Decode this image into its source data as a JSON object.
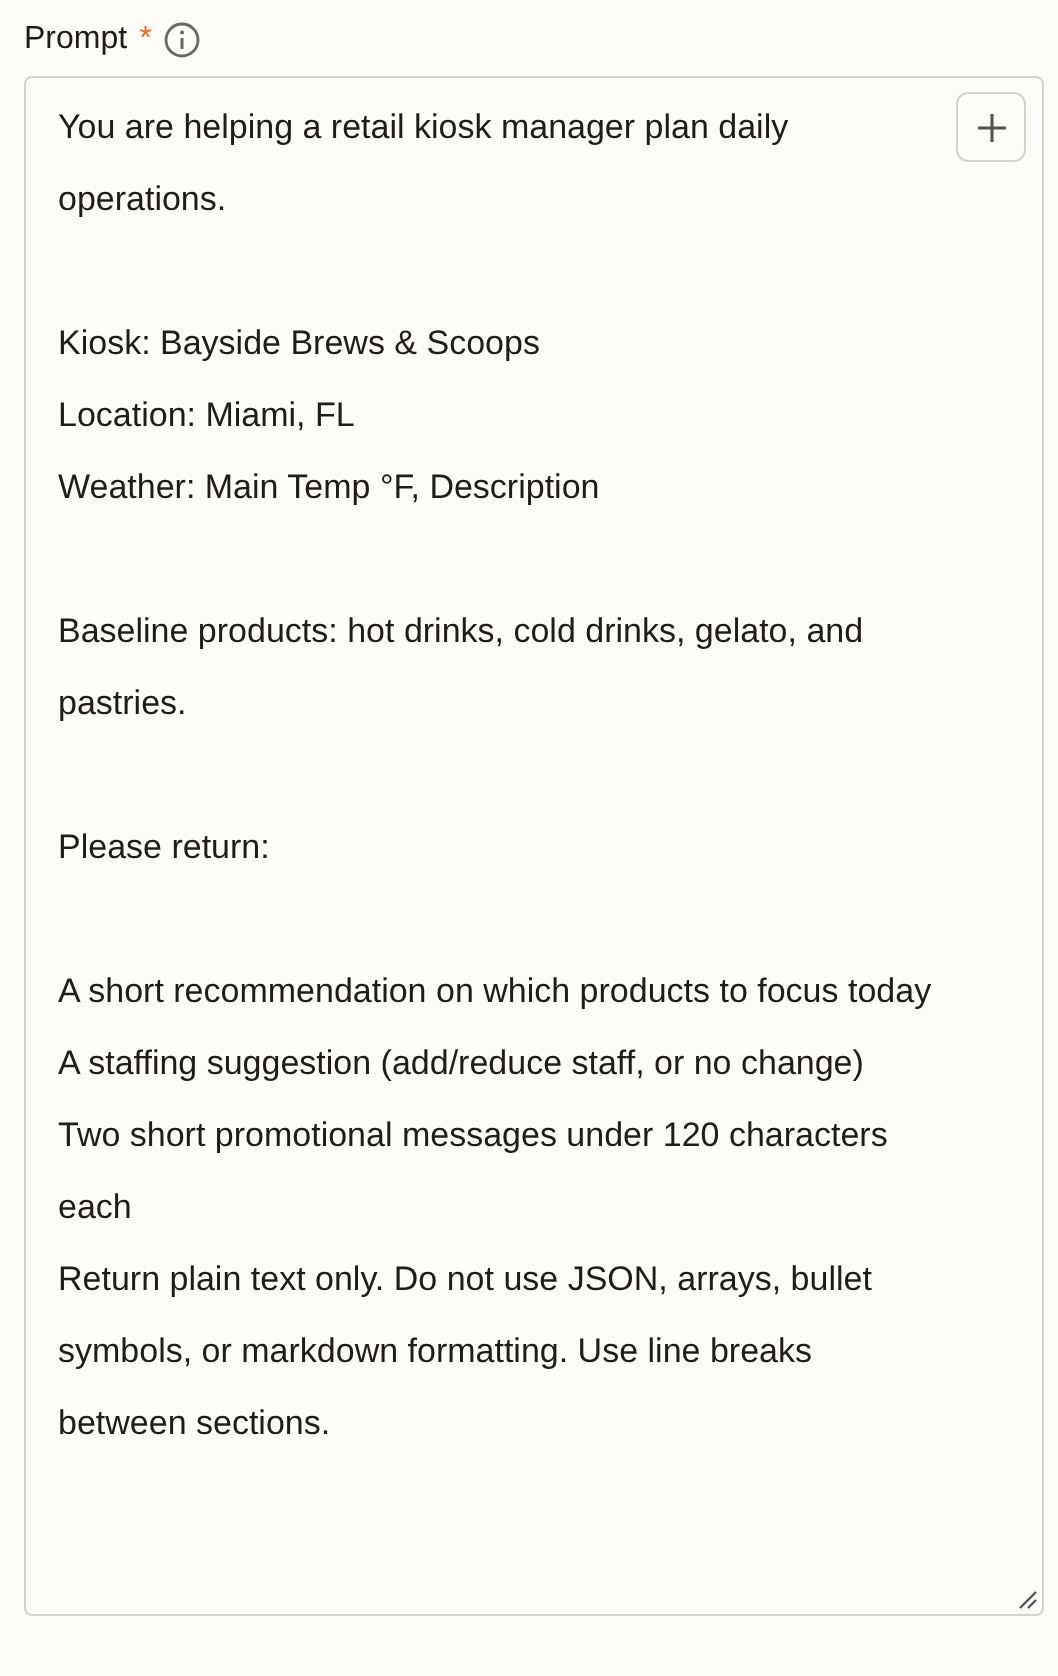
{
  "field": {
    "label": "Prompt",
    "required_mark": "*",
    "required": true
  },
  "prompt_sections": [
    [
      "You are helping a retail kiosk manager plan daily operations."
    ],
    [
      "Kiosk: Bayside Brews & Scoops",
      "Location: Miami, FL",
      "Weather: Main Temp °F, Description"
    ],
    [
      "Baseline products: hot drinks, cold drinks, gelato, and pastries."
    ],
    [
      "Please return:"
    ],
    [
      "A short recommendation on which products to focus today",
      "A staffing suggestion (add/reduce staff, or no change)",
      "Two short promotional messages under 120 characters each",
      "Return plain text only. Do not use JSON, arrays, bullet symbols, or markdown formatting. Use line breaks between sections."
    ]
  ]
}
